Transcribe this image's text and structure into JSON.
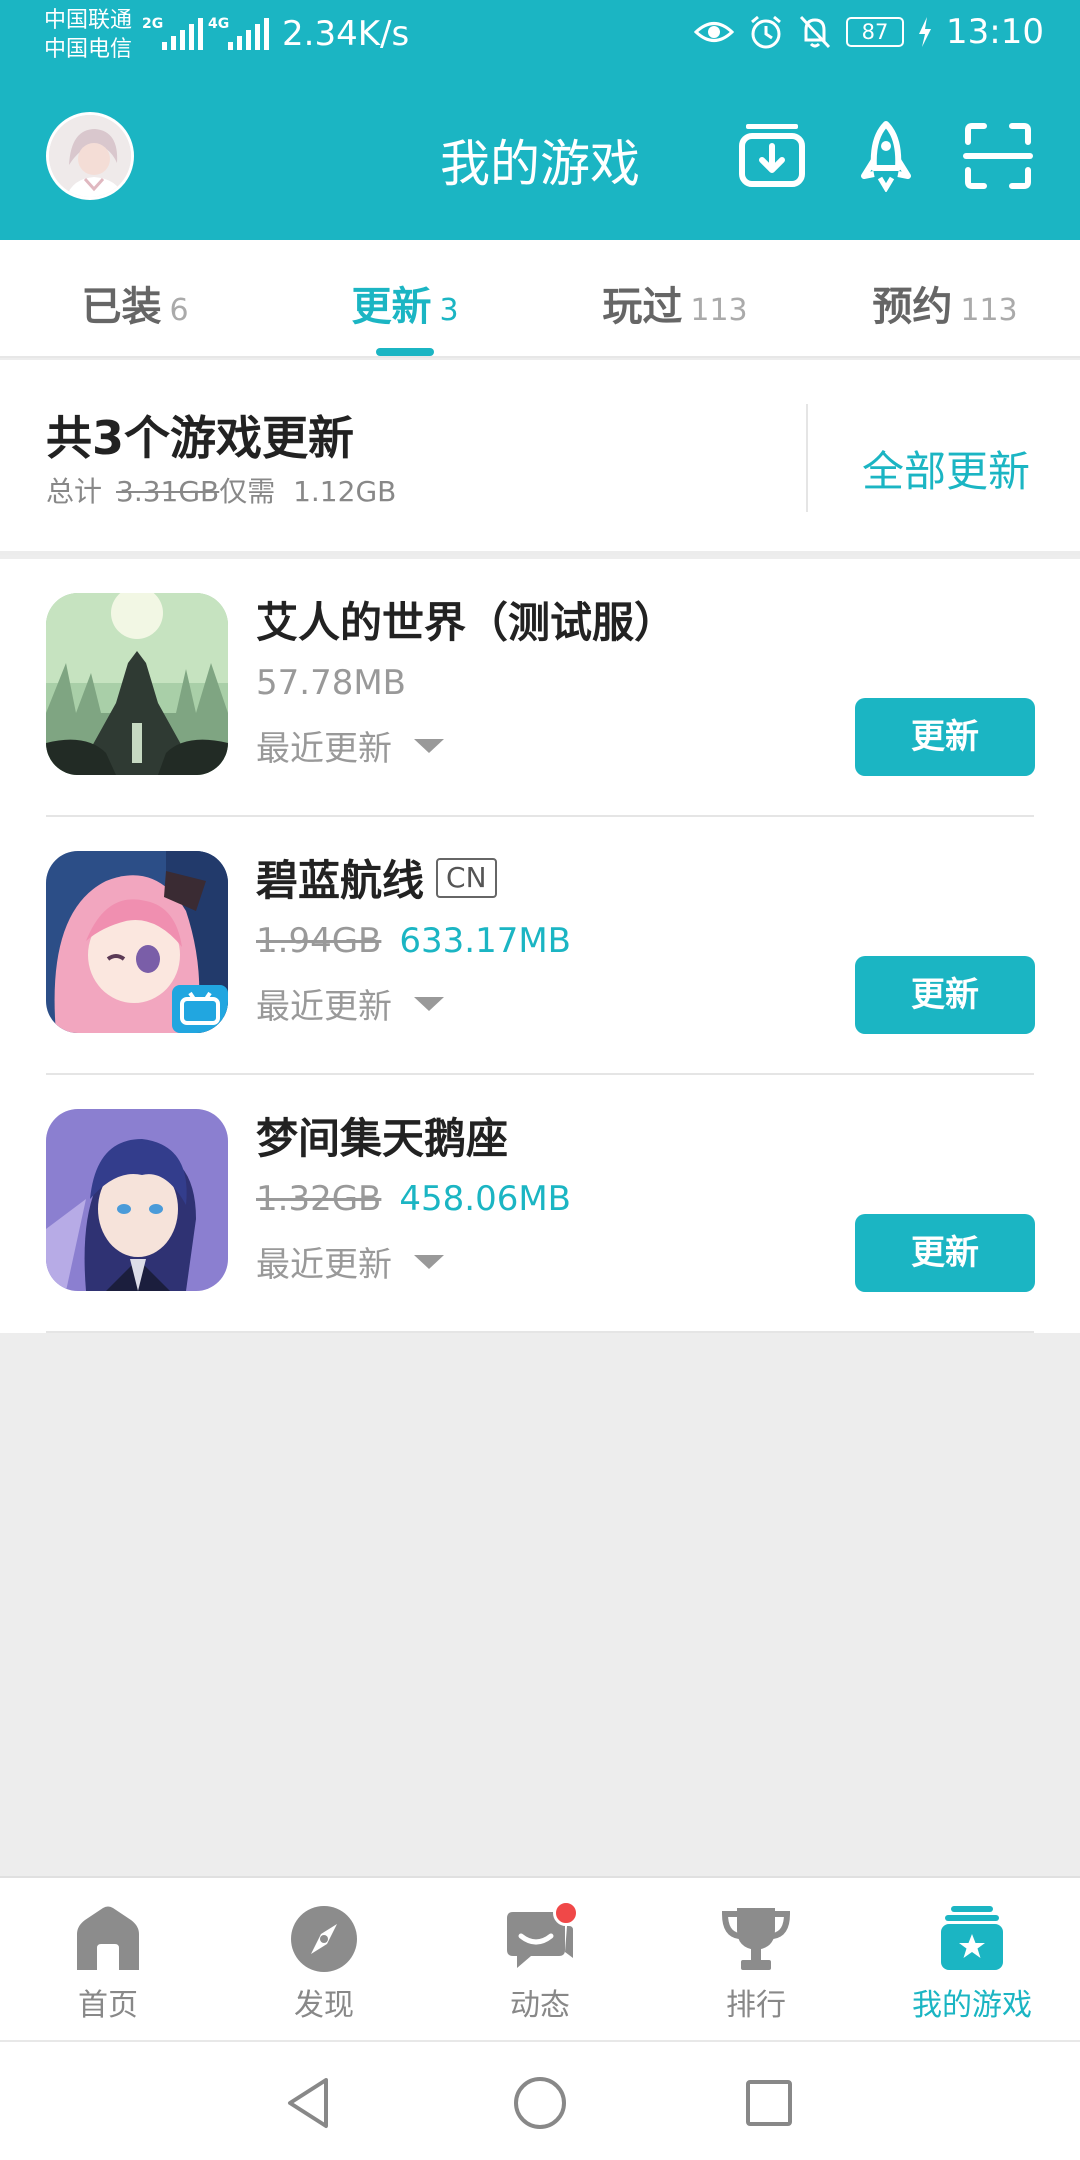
{
  "status_bar": {
    "carrier_1": "中国联通",
    "carrier_2": "中国电信",
    "net_1": "2G",
    "net_2": "4G",
    "net_speed": "2.34K/s",
    "battery": "87",
    "time": "13:10",
    "icons": [
      "eye-icon",
      "alarm-icon",
      "mute-bell-icon",
      "battery-icon",
      "charging-icon"
    ]
  },
  "header": {
    "title": "我的游戏",
    "icons": [
      "download-icon",
      "rocket-icon",
      "scan-icon"
    ]
  },
  "tabs": [
    {
      "label": "已装",
      "count": "6",
      "active": false
    },
    {
      "label": "更新",
      "count": "3",
      "active": true
    },
    {
      "label": "玩过",
      "count": "113",
      "active": false
    },
    {
      "label": "预约",
      "count": "113",
      "active": false
    }
  ],
  "summary": {
    "title": "共3个游戏更新",
    "total_label": "总计",
    "original_size": "3.31GB",
    "need_label": "仅需",
    "need_size": "1.12GB",
    "update_all": "全部更新"
  },
  "games": [
    {
      "name": "艾人的世界（测试服）",
      "badge": "",
      "old_size": "",
      "new_size": "57.78MB",
      "recent": "最近更新",
      "button": "更新"
    },
    {
      "name": "碧蓝航线",
      "badge": "CN",
      "old_size": "1.94GB",
      "new_size": "633.17MB",
      "recent": "最近更新",
      "button": "更新"
    },
    {
      "name": "梦间集天鹅座",
      "badge": "",
      "old_size": "1.32GB",
      "new_size": "458.06MB",
      "recent": "最近更新",
      "button": "更新"
    }
  ],
  "bottom_nav": [
    {
      "label": "首页",
      "icon": "home-icon",
      "active": false
    },
    {
      "label": "发现",
      "icon": "compass-icon",
      "active": false
    },
    {
      "label": "动态",
      "icon": "chat-icon",
      "active": false,
      "notification_dot": true
    },
    {
      "label": "排行",
      "icon": "trophy-icon",
      "active": false
    },
    {
      "label": "我的游戏",
      "icon": "my-games-icon",
      "active": true
    }
  ],
  "colors": {
    "accent": "#1bb5c3",
    "background": "#ededed",
    "notification": "#f04848"
  }
}
